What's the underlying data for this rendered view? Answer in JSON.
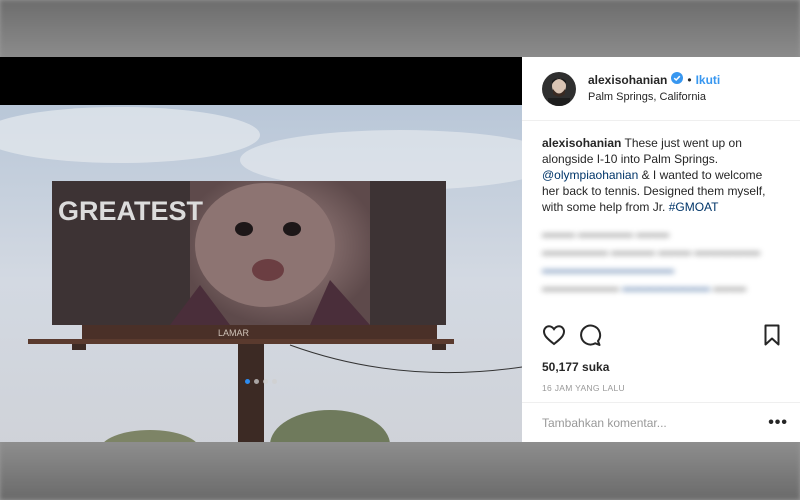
{
  "post": {
    "username": "alexisohanian",
    "separator": "•",
    "follow_label": "Ikuti",
    "location": "Palm Springs, California",
    "caption": {
      "username": "alexisohanian",
      "part1": " These just went up on alongside I-10 into Palm Springs. ",
      "mention": "@olympiaohanian",
      "part2": " & I wanted to welcome her back to tennis. Designed them myself, with some help from Jr. ",
      "hashtag": "#GMOAT"
    },
    "likes": "50,177 suka",
    "timestamp": "16 JAM YANG LALU",
    "comment_placeholder": "Tambahkan komentar...",
    "more_label": "•••"
  },
  "billboard": {
    "headline": "GREATEST",
    "brand": "LAMAR"
  },
  "carousel": {
    "count": 4,
    "active_index": 0
  },
  "icons": [
    "verified-badge-icon",
    "heart-icon",
    "comment-icon",
    "bookmark-icon",
    "more-options-icon"
  ],
  "colors": {
    "accent": "#3897f0",
    "verified": "#3897f0",
    "link": "#003569",
    "text": "#262626",
    "muted": "#999999"
  }
}
